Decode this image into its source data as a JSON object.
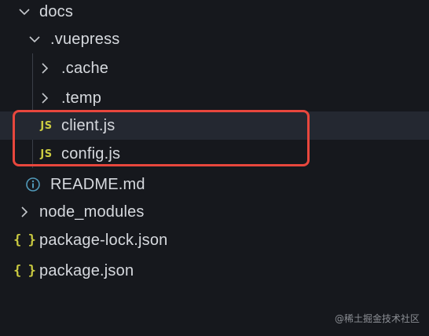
{
  "tree": {
    "docs": {
      "label": "docs",
      "icon": "chevron-down-icon"
    },
    "vuepress": {
      "label": ".vuepress",
      "icon": "chevron-down-icon"
    },
    "cache": {
      "label": ".cache",
      "icon": "chevron-right-icon"
    },
    "temp": {
      "label": ".temp",
      "icon": "chevron-right-icon"
    },
    "client": {
      "label": "client.js",
      "icon_text": "JS"
    },
    "config": {
      "label": "config.js",
      "icon_text": "JS"
    },
    "readme": {
      "label": "README.md",
      "icon": "info-icon"
    },
    "node_modules": {
      "label": "node_modules",
      "icon": "chevron-right-icon"
    },
    "package_lock": {
      "label": "package-lock.json",
      "icon_text": "{ }"
    },
    "package": {
      "label": "package.json",
      "icon_text": "{ }"
    }
  },
  "colors": {
    "background": "#16181d",
    "text": "#d6d9de",
    "js_icon": "#cbcb41",
    "highlight": "#e8473d"
  },
  "watermark": "@稀土掘金技术社区"
}
